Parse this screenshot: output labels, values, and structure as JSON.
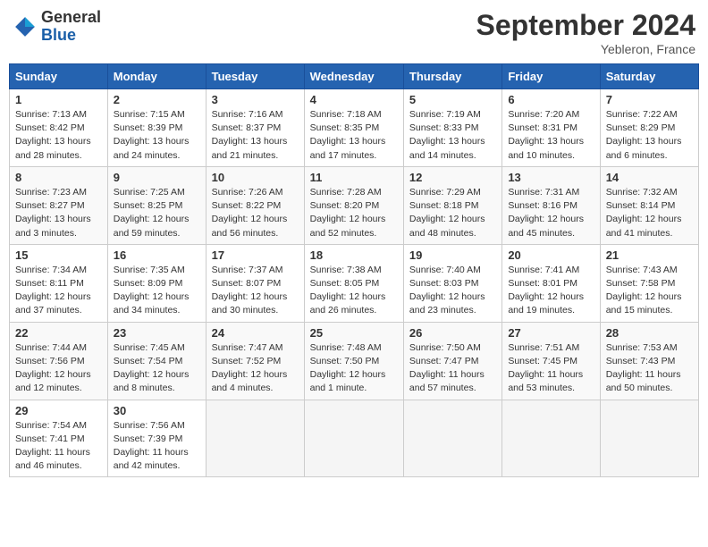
{
  "header": {
    "logo_general": "General",
    "logo_blue": "Blue",
    "month_title": "September 2024",
    "location": "Yebleron, France"
  },
  "weekdays": [
    "Sunday",
    "Monday",
    "Tuesday",
    "Wednesday",
    "Thursday",
    "Friday",
    "Saturday"
  ],
  "weeks": [
    [
      {
        "day": "1",
        "sunrise": "7:13 AM",
        "sunset": "8:42 PM",
        "daylight": "13 hours and 28 minutes."
      },
      {
        "day": "2",
        "sunrise": "7:15 AM",
        "sunset": "8:39 PM",
        "daylight": "13 hours and 24 minutes."
      },
      {
        "day": "3",
        "sunrise": "7:16 AM",
        "sunset": "8:37 PM",
        "daylight": "13 hours and 21 minutes."
      },
      {
        "day": "4",
        "sunrise": "7:18 AM",
        "sunset": "8:35 PM",
        "daylight": "13 hours and 17 minutes."
      },
      {
        "day": "5",
        "sunrise": "7:19 AM",
        "sunset": "8:33 PM",
        "daylight": "13 hours and 14 minutes."
      },
      {
        "day": "6",
        "sunrise": "7:20 AM",
        "sunset": "8:31 PM",
        "daylight": "13 hours and 10 minutes."
      },
      {
        "day": "7",
        "sunrise": "7:22 AM",
        "sunset": "8:29 PM",
        "daylight": "13 hours and 6 minutes."
      }
    ],
    [
      {
        "day": "8",
        "sunrise": "7:23 AM",
        "sunset": "8:27 PM",
        "daylight": "13 hours and 3 minutes."
      },
      {
        "day": "9",
        "sunrise": "7:25 AM",
        "sunset": "8:25 PM",
        "daylight": "12 hours and 59 minutes."
      },
      {
        "day": "10",
        "sunrise": "7:26 AM",
        "sunset": "8:22 PM",
        "daylight": "12 hours and 56 minutes."
      },
      {
        "day": "11",
        "sunrise": "7:28 AM",
        "sunset": "8:20 PM",
        "daylight": "12 hours and 52 minutes."
      },
      {
        "day": "12",
        "sunrise": "7:29 AM",
        "sunset": "8:18 PM",
        "daylight": "12 hours and 48 minutes."
      },
      {
        "day": "13",
        "sunrise": "7:31 AM",
        "sunset": "8:16 PM",
        "daylight": "12 hours and 45 minutes."
      },
      {
        "day": "14",
        "sunrise": "7:32 AM",
        "sunset": "8:14 PM",
        "daylight": "12 hours and 41 minutes."
      }
    ],
    [
      {
        "day": "15",
        "sunrise": "7:34 AM",
        "sunset": "8:11 PM",
        "daylight": "12 hours and 37 minutes."
      },
      {
        "day": "16",
        "sunrise": "7:35 AM",
        "sunset": "8:09 PM",
        "daylight": "12 hours and 34 minutes."
      },
      {
        "day": "17",
        "sunrise": "7:37 AM",
        "sunset": "8:07 PM",
        "daylight": "12 hours and 30 minutes."
      },
      {
        "day": "18",
        "sunrise": "7:38 AM",
        "sunset": "8:05 PM",
        "daylight": "12 hours and 26 minutes."
      },
      {
        "day": "19",
        "sunrise": "7:40 AM",
        "sunset": "8:03 PM",
        "daylight": "12 hours and 23 minutes."
      },
      {
        "day": "20",
        "sunrise": "7:41 AM",
        "sunset": "8:01 PM",
        "daylight": "12 hours and 19 minutes."
      },
      {
        "day": "21",
        "sunrise": "7:43 AM",
        "sunset": "7:58 PM",
        "daylight": "12 hours and 15 minutes."
      }
    ],
    [
      {
        "day": "22",
        "sunrise": "7:44 AM",
        "sunset": "7:56 PM",
        "daylight": "12 hours and 12 minutes."
      },
      {
        "day": "23",
        "sunrise": "7:45 AM",
        "sunset": "7:54 PM",
        "daylight": "12 hours and 8 minutes."
      },
      {
        "day": "24",
        "sunrise": "7:47 AM",
        "sunset": "7:52 PM",
        "daylight": "12 hours and 4 minutes."
      },
      {
        "day": "25",
        "sunrise": "7:48 AM",
        "sunset": "7:50 PM",
        "daylight": "12 hours and 1 minute."
      },
      {
        "day": "26",
        "sunrise": "7:50 AM",
        "sunset": "7:47 PM",
        "daylight": "11 hours and 57 minutes."
      },
      {
        "day": "27",
        "sunrise": "7:51 AM",
        "sunset": "7:45 PM",
        "daylight": "11 hours and 53 minutes."
      },
      {
        "day": "28",
        "sunrise": "7:53 AM",
        "sunset": "7:43 PM",
        "daylight": "11 hours and 50 minutes."
      }
    ],
    [
      {
        "day": "29",
        "sunrise": "7:54 AM",
        "sunset": "7:41 PM",
        "daylight": "11 hours and 46 minutes."
      },
      {
        "day": "30",
        "sunrise": "7:56 AM",
        "sunset": "7:39 PM",
        "daylight": "11 hours and 42 minutes."
      },
      null,
      null,
      null,
      null,
      null
    ]
  ]
}
